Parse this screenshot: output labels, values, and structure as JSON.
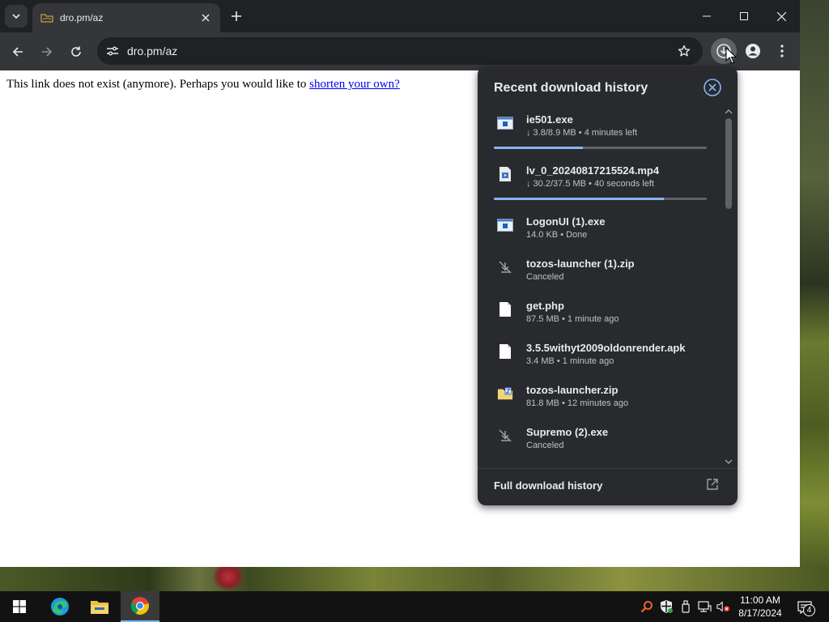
{
  "browser": {
    "tab": {
      "title": "dro.pm/az"
    },
    "toolbar": {
      "url": "dro.pm/az"
    }
  },
  "page": {
    "text": "This link does not exist (anymore). Perhaps you would like to",
    "link_text": "shorten your own?"
  },
  "downloads": {
    "title": "Recent download history",
    "items": [
      {
        "name": "ie501.exe",
        "status": "↓ 3.8/8.9 MB • 4 minutes left",
        "icon": "installer-icon",
        "progress": 0.42
      },
      {
        "name": "lv_0_20240817215524.mp4",
        "status": "↓ 30.2/37.5 MB • 40 seconds left",
        "icon": "video-file-icon",
        "progress": 0.8
      },
      {
        "name": "LogonUI (1).exe",
        "status": "14.0 KB • Done",
        "icon": "installer-icon"
      },
      {
        "name": "tozos-launcher (1).zip",
        "status": "Canceled",
        "icon": "canceled-download-icon"
      },
      {
        "name": "get.php",
        "status": "87.5 MB • 1 minute ago",
        "icon": "file-icon"
      },
      {
        "name": "3.5.5withyt2009oldonrender.apk",
        "status": "3.4 MB • 1 minute ago",
        "icon": "file-icon"
      },
      {
        "name": "tozos-launcher.zip",
        "status": "81.8 MB • 12 minutes ago",
        "icon": "zip-folder-icon"
      },
      {
        "name": "Supremo (2).exe",
        "status": "Canceled",
        "icon": "canceled-download-icon"
      }
    ],
    "footer_label": "Full download history"
  },
  "taskbar": {
    "time": "11:00 AM",
    "date": "8/17/2024",
    "notification_count": "4"
  },
  "colors": {
    "panel_bg": "#292a2d",
    "progress": "#8ab4f8",
    "toolbar": "#35363a",
    "link": "#0000ee"
  }
}
